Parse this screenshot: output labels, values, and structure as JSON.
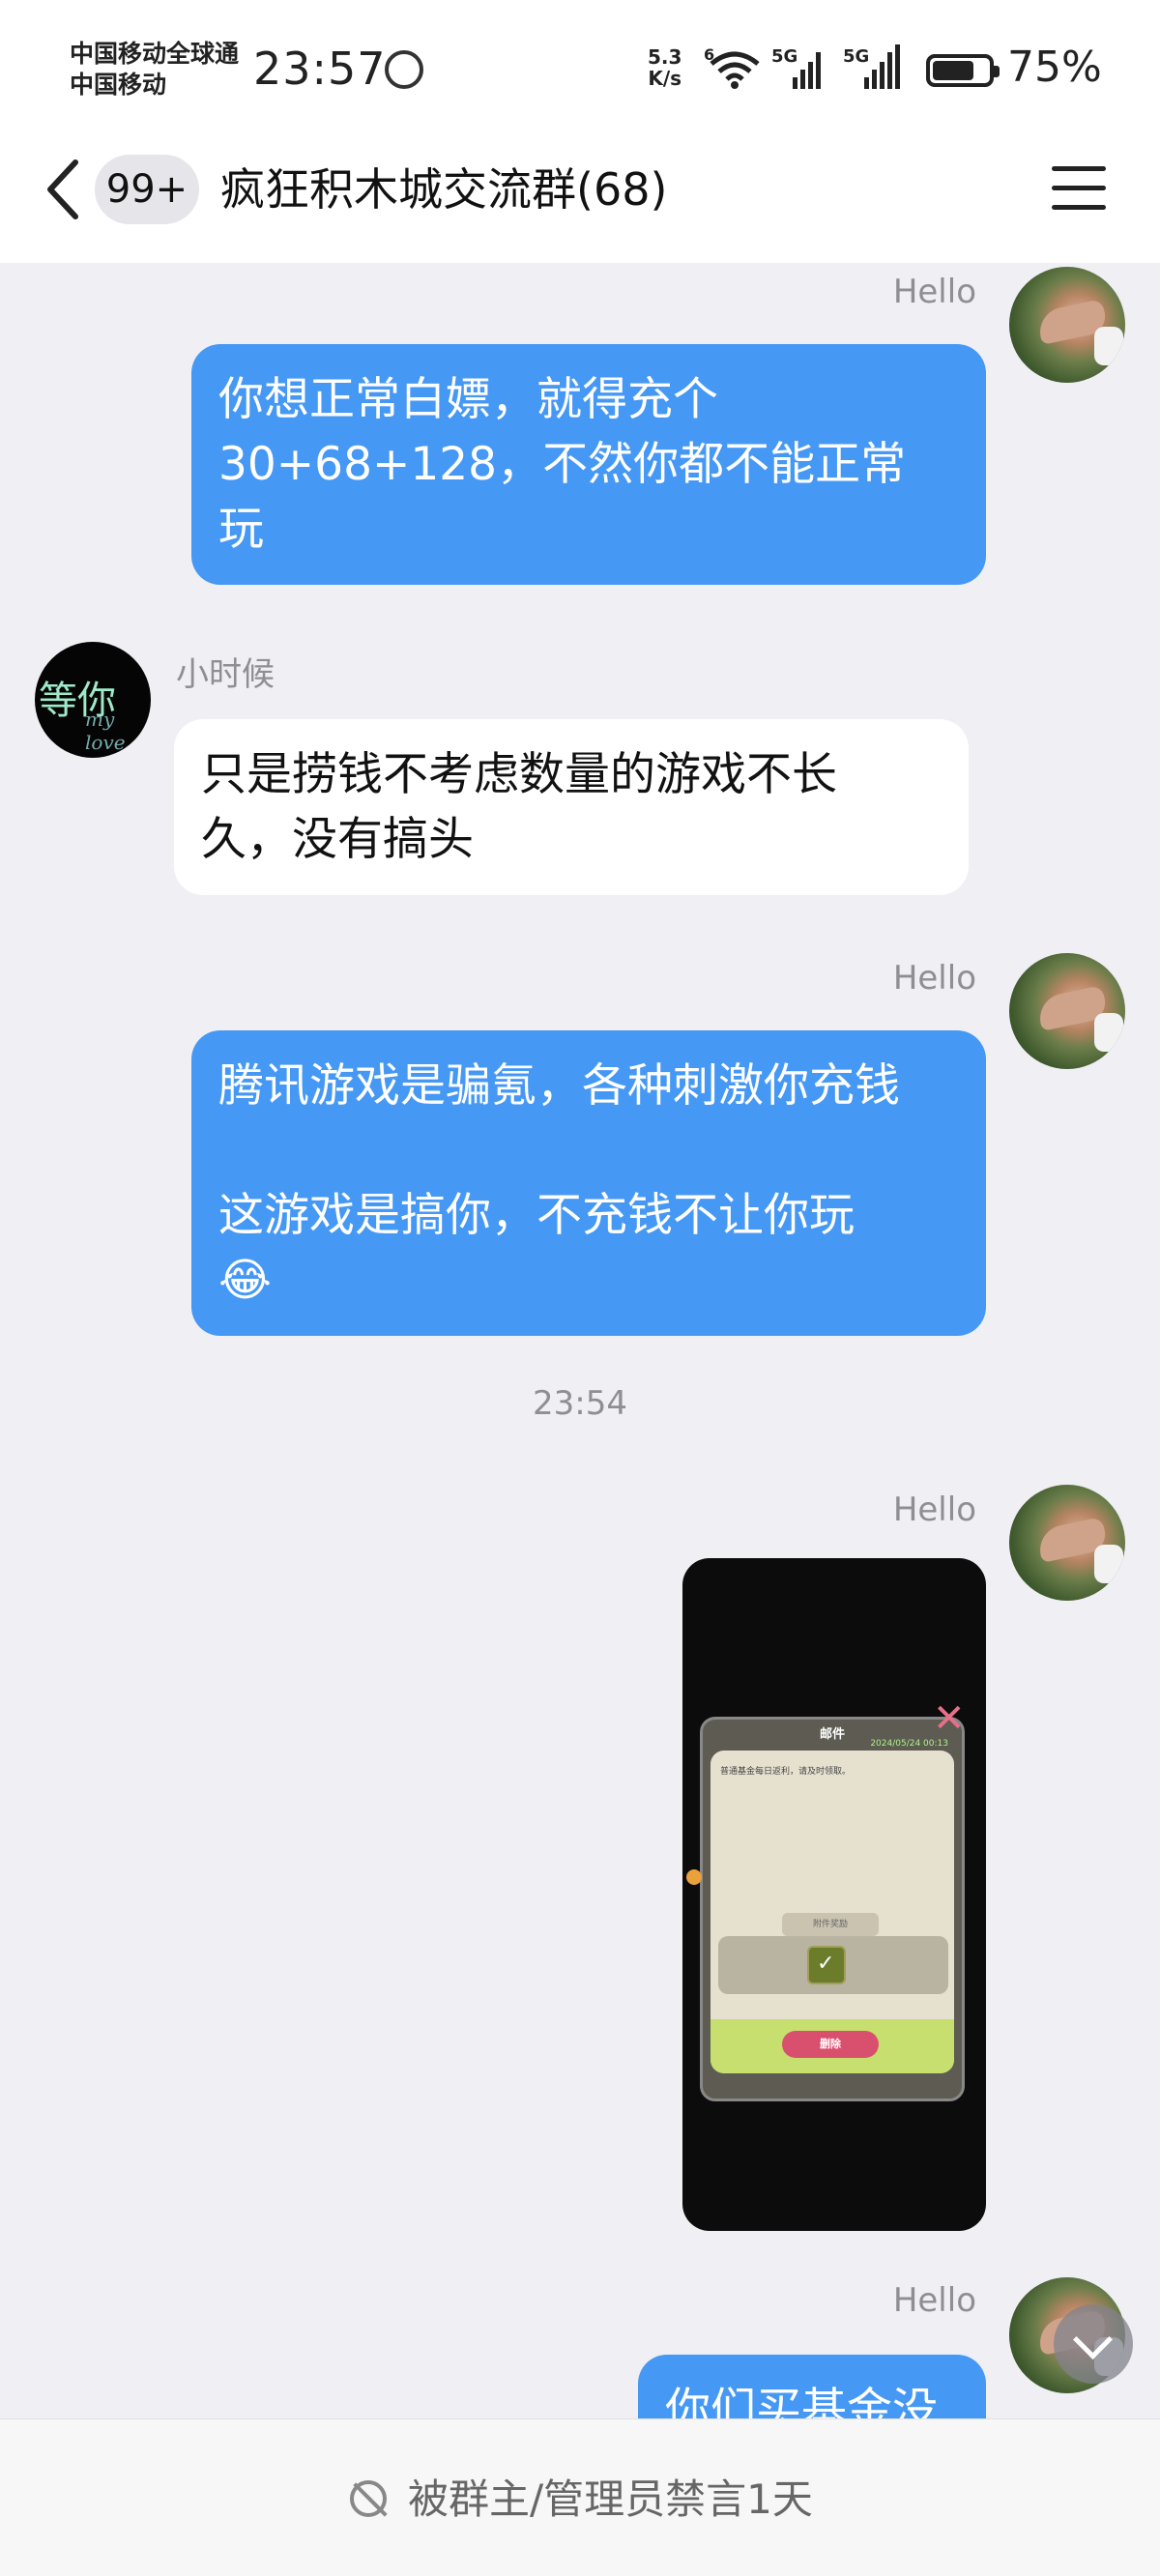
{
  "status_bar": {
    "carrier_line1": "中国移动全球通",
    "carrier_line2": "中国移动",
    "time": "23:57",
    "net_speed_value": "5.3",
    "net_speed_unit": "K/s",
    "wifi_label": "6",
    "signal1_label": "5G",
    "signal2_label": "5G",
    "battery_percent": "75%",
    "battery_level": 0.75
  },
  "header": {
    "back_icon": "chevron-left-icon",
    "unread_badge": "99+",
    "title": "疯狂积木城交流群(68)",
    "menu_icon": "hamburger-menu-icon"
  },
  "messages": [
    {
      "sender": "Hello",
      "side": "right",
      "text": "你想正常白嫖，就得充个\n30+68+128，不然你都不能正常\n玩"
    },
    {
      "sender": "小时候",
      "side": "left",
      "avatar_text": "等你",
      "avatar_subtext": "my love",
      "text": "只是捞钱不考虑数量的游戏不长\n久，没有搞头"
    },
    {
      "sender": "Hello",
      "side": "right",
      "text": "腾讯游戏是骗氪，各种刺激你充钱\n\n这游戏是搞你，不充钱不让你玩\n😂"
    },
    {
      "sender": "Hello",
      "side": "right",
      "text": "你们买基金没"
    }
  ],
  "timestamp": "23:54",
  "image_message": {
    "sender": "Hello",
    "mail_title": "邮件",
    "mail_date": "2024/05/24 00:13",
    "mail_body": "普通基金每日返利，请及时领取。",
    "attachment_label": "附件奖励",
    "delete_label": "删除"
  },
  "bottom_bar": {
    "mute_icon": "muted-icon",
    "mute_text": "被群主/管理员禁言1天"
  },
  "colors": {
    "my_bubble": "#4698f5",
    "their_bubble": "#ffffff",
    "chat_background": "#efeff4"
  }
}
